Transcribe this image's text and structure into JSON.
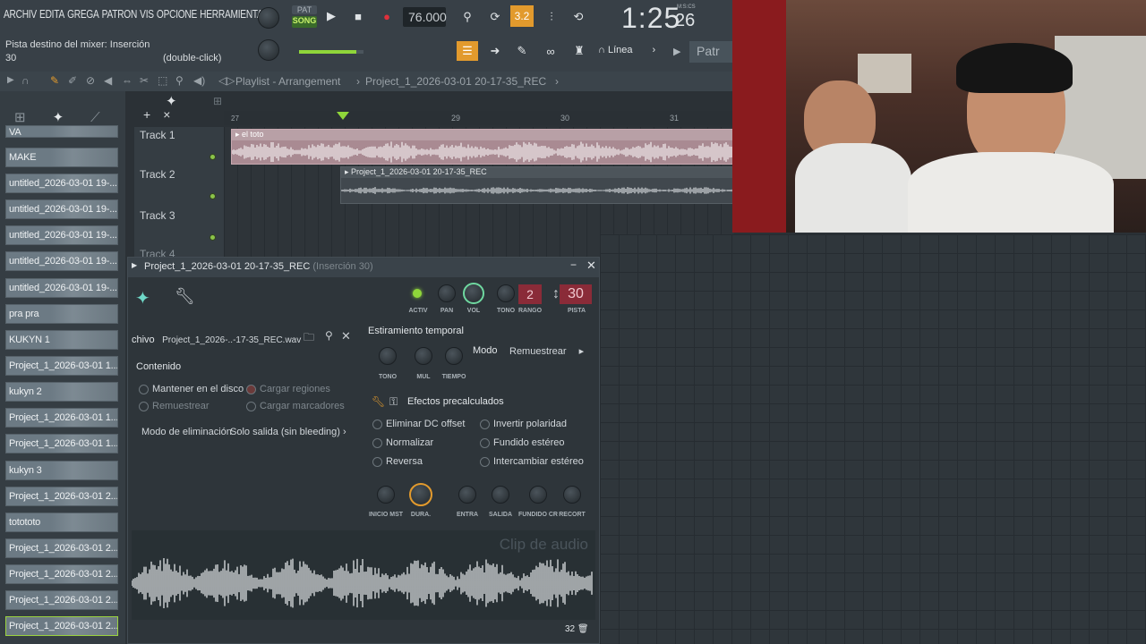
{
  "menu": {
    "items": [
      "ARCHIV",
      "EDITA",
      "GREGA",
      "PATRON",
      "VIS",
      "OPCIONE",
      "HERRAMIENTA"
    ]
  },
  "transport": {
    "pat_label": "PAT",
    "song_label": "SONG",
    "tempo": "76.000",
    "time": "1:25",
    "time_small": "26",
    "time_unit": "M:S:CS",
    "beats_label": "3.2"
  },
  "hint": {
    "line1": "Pista destino del mixer: Inserción",
    "line2": "30",
    "line3": "(double-click)"
  },
  "snap": {
    "label": "Línea",
    "pattern_label": "Patr"
  },
  "playlist": {
    "title": "Playlist - Arrangement",
    "project": "Project_1_2026-03-01 20-17-35_REC",
    "ruler": [
      "27",
      "29",
      "30",
      "31"
    ],
    "tracks": [
      "Track 1",
      "Track 2",
      "Track 3",
      "Track 4"
    ],
    "clip1": "el toto",
    "clip2": "Project_1_2026-03-01 20-17-35_REC"
  },
  "picker": [
    "VA",
    "MAKE",
    "untitled_2026-03-01 19-...",
    "untitled_2026-03-01 19-...",
    "untitled_2026-03-01 19-...",
    "untitled_2026-03-01 19-...",
    "untitled_2026-03-01 19-...",
    "pra pra",
    "KUKYN 1",
    "Project_1_2026-03-01 1...",
    "kukyn 2",
    "Project_1_2026-03-01 1...",
    "Project_1_2026-03-01 1...",
    "kukyn 3",
    "Project_1_2026-03-01 2...",
    "totototo",
    "Project_1_2026-03-01 2...",
    "Project_1_2026-03-01 2...",
    "Project_1_2026-03-01 2...",
    "Project_1_2026-03-01 2..."
  ],
  "channel": {
    "title": "Project_1_2026-03-01 20-17-35_REC",
    "insert": "(Inserción 30)",
    "knobs": {
      "activ": "ACTIV",
      "pan": "PAN",
      "vol": "VOL",
      "tono": "TONO",
      "rango": "RANGO",
      "pista": "PISTA"
    },
    "rango_value": "2",
    "pista_value": "30",
    "file_label": "chivo",
    "file_name": "Project_1_2026-..-17-35_REC.wav",
    "contenido": "Contenido",
    "mantener": "Mantener en el disco",
    "cargar_regiones": "Cargar regiones",
    "remuestrear": "Remuestrear",
    "cargar_marcadores": "Cargar marcadores",
    "modo_elim": "Modo de eliminación",
    "sin_bleeding": "Solo salida (sin bleeding)",
    "estiramiento": "Estiramiento temporal",
    "str_knobs": [
      "TONO",
      "MUL",
      "TIEMPO"
    ],
    "modo": "Modo",
    "modo_value": "Remuestrear",
    "efectos": "Efectos precalculados",
    "fx_left": [
      "Eliminar DC offset",
      "Normalizar",
      "Reversa"
    ],
    "fx_right": [
      "Invertir polaridad",
      "Fundido estéreo",
      "Intercambiar estéreo"
    ],
    "bottom_knobs": [
      "INICIO MST",
      "DURA.",
      "ENTRA",
      "SALIDA",
      "FUNDIDO CR",
      "RECORT"
    ],
    "clip_label": "Clip de audio",
    "zoom": "32"
  }
}
